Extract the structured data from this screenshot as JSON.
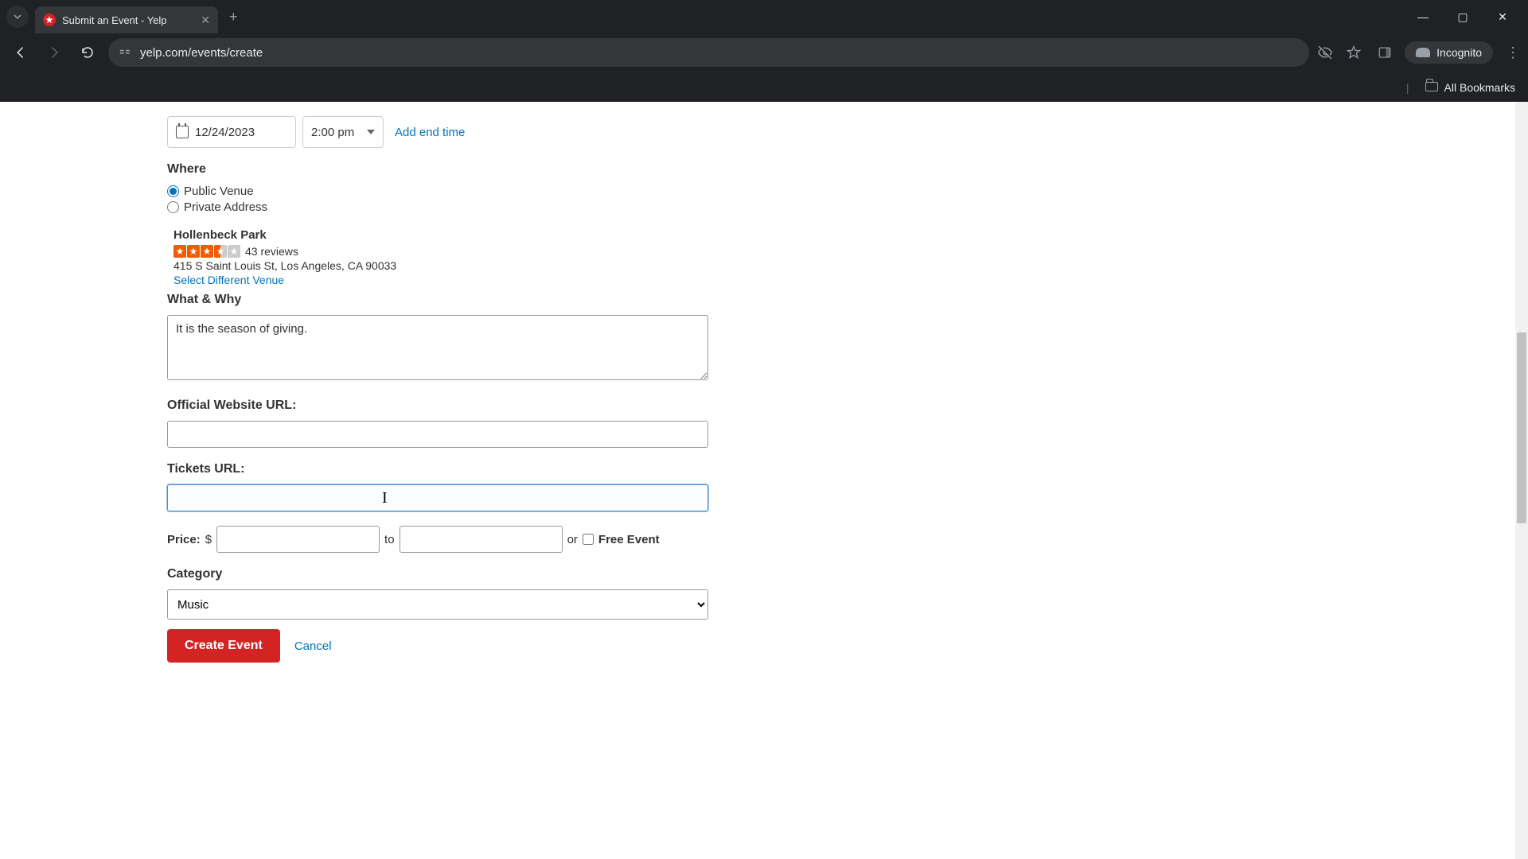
{
  "browser": {
    "tab_title": "Submit an Event - Yelp",
    "url": "yelp.com/events/create",
    "incognito_label": "Incognito",
    "all_bookmarks": "All Bookmarks"
  },
  "form": {
    "date_value": "12/24/2023",
    "time_value": "2:00 pm",
    "add_end_time": "Add end time",
    "where_label": "Where",
    "venue_public": "Public Venue",
    "venue_private": "Private Address",
    "venue": {
      "name": "Hollenbeck Park",
      "review_count": "43 reviews",
      "address": "415 S Saint Louis St, Los Angeles, CA 90033",
      "select_different": "Select Different Venue"
    },
    "what_why_label": "What & Why",
    "what_why_value": "It is the season of giving.",
    "website_label": "Official Website URL:",
    "website_value": "",
    "tickets_label": "Tickets URL:",
    "tickets_value": "",
    "price_label": "Price:",
    "currency": "$",
    "price_to": "to",
    "price_or": "or",
    "free_event": "Free Event",
    "category_label": "Category",
    "category_value": "Music",
    "create_btn": "Create Event",
    "cancel": "Cancel"
  }
}
